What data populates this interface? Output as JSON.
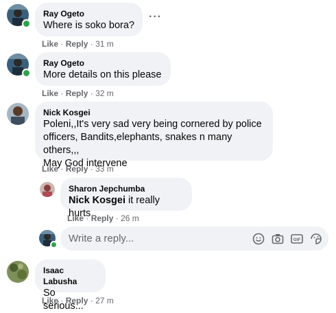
{
  "comments": [
    {
      "author": "Ray Ogeto",
      "text": "Where is soko bora?",
      "like": "Like",
      "reply": "Reply",
      "time": "31 m"
    },
    {
      "author": "Ray Ogeto",
      "text": "More details on this please",
      "like": "Like",
      "reply": "Reply",
      "time": "32 m"
    },
    {
      "author": "Nick Kosgei",
      "lines": [
        "Poleni,,It's very sad very being cornered by police",
        "officers, Bandits,elephants, snakes n many others,,,",
        "May God intervene"
      ],
      "like": "Like",
      "reply": "Reply",
      "time": "33 m"
    },
    {
      "author": "Sharon Jepchumba",
      "tag": "Nick Kosgei",
      "text": " it really hurts",
      "like": "Like",
      "reply": "Reply",
      "time": "26 m"
    },
    {
      "author": "Isaac Labusha",
      "text": "So serious...",
      "like": "Like",
      "reply": "Reply",
      "time": "27 m"
    }
  ],
  "reply_box": {
    "placeholder": "Write a reply..."
  },
  "more_options": "···",
  "separator": "·",
  "colors": {
    "bubble": "#f0f2f5",
    "online": "#31a24c",
    "meta": "#65676b"
  }
}
